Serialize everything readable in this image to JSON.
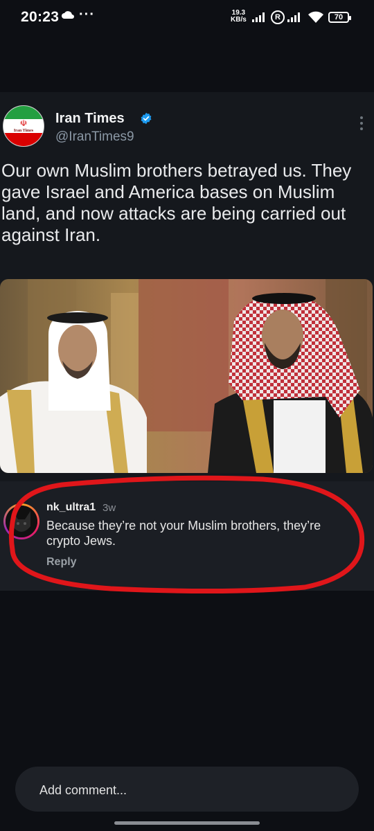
{
  "status_bar": {
    "time": "20:23",
    "more_indicator": "···",
    "net_speed_value": "19.3",
    "net_speed_unit": "KB/s",
    "roaming_label": "R",
    "battery": "70"
  },
  "tweet": {
    "avatar_text": "Iran Times",
    "name": "Iran Times",
    "handle": "@IranTimes9",
    "verified": true,
    "text": "Our own Muslim brothers betrayed us. They gave Israel and America bases on Muslim land, and now attacks are being carried out against Iran."
  },
  "comment": {
    "username": "nk_ultra1",
    "time_ago": "3w",
    "text": "Because they’re not your Muslim brothers, they’re crypto Jews.",
    "reply_label": "Reply",
    "annotation_color": "#e0161a"
  },
  "composer": {
    "placeholder": "Add comment..."
  },
  "colors": {
    "background": "#0d0f14",
    "card": "#15181d",
    "verified_blue": "#1d9bf0"
  }
}
